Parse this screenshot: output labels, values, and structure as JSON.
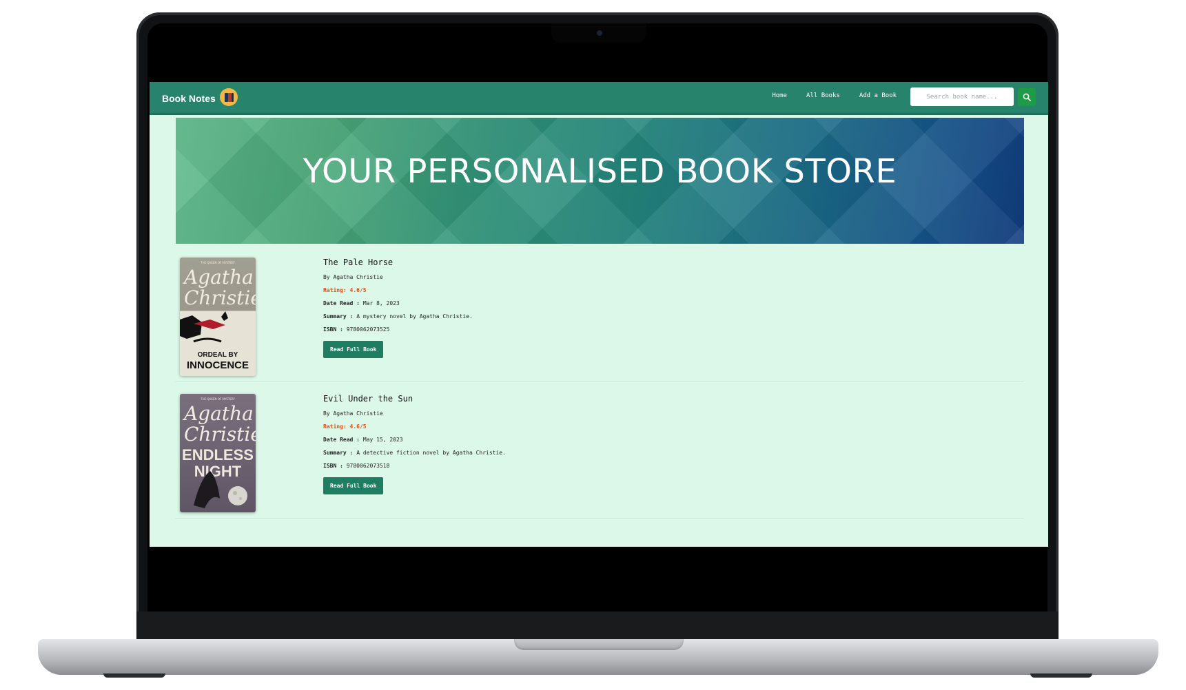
{
  "navbar": {
    "brand": "Book Notes",
    "links": [
      "Home",
      "All Books",
      "Add a Book"
    ],
    "search_placeholder": "Search book name..."
  },
  "banner": {
    "title": "YOUR PERSONALISED BOOK STORE"
  },
  "books": [
    {
      "title": "The Pale Horse",
      "author_line": "By Agatha Christie",
      "rating": "Rating: 4.6/5",
      "date_label": "Date Read :",
      "date_value": "Mar 8, 2023",
      "summary_label": "Summary :",
      "summary_value": "A mystery novel by Agatha Christie.",
      "isbn_label": "ISBN :",
      "isbn_value": "9780062073525",
      "button": "Read Full Book",
      "cover": {
        "series": "THE QUEEN OF MYSTERY",
        "author": "Agatha Christie",
        "title_line1": "ORDEAL BY",
        "title_line2": "INNOCENCE"
      }
    },
    {
      "title": "Evil Under the Sun",
      "author_line": "By Agatha Christie",
      "rating": "Rating: 4.6/5",
      "date_label": "Date Read :",
      "date_value": "May 15, 2023",
      "summary_label": "Summary :",
      "summary_value": "A detective fiction novel by Agatha Christie.",
      "isbn_label": "ISBN :",
      "isbn_value": "9780062073518",
      "button": "Read Full Book",
      "cover": {
        "series": "THE QUEEN OF MYSTERY",
        "author": "Agatha Christie",
        "title_line1": "ENDLESS",
        "title_line2": "NIGHT"
      }
    }
  ],
  "colors": {
    "navbar": "#27836b",
    "page_bg": "#dcf8e8",
    "button": "#1f7d61",
    "search_button": "#1e9c45",
    "rating": "#e0501a"
  }
}
